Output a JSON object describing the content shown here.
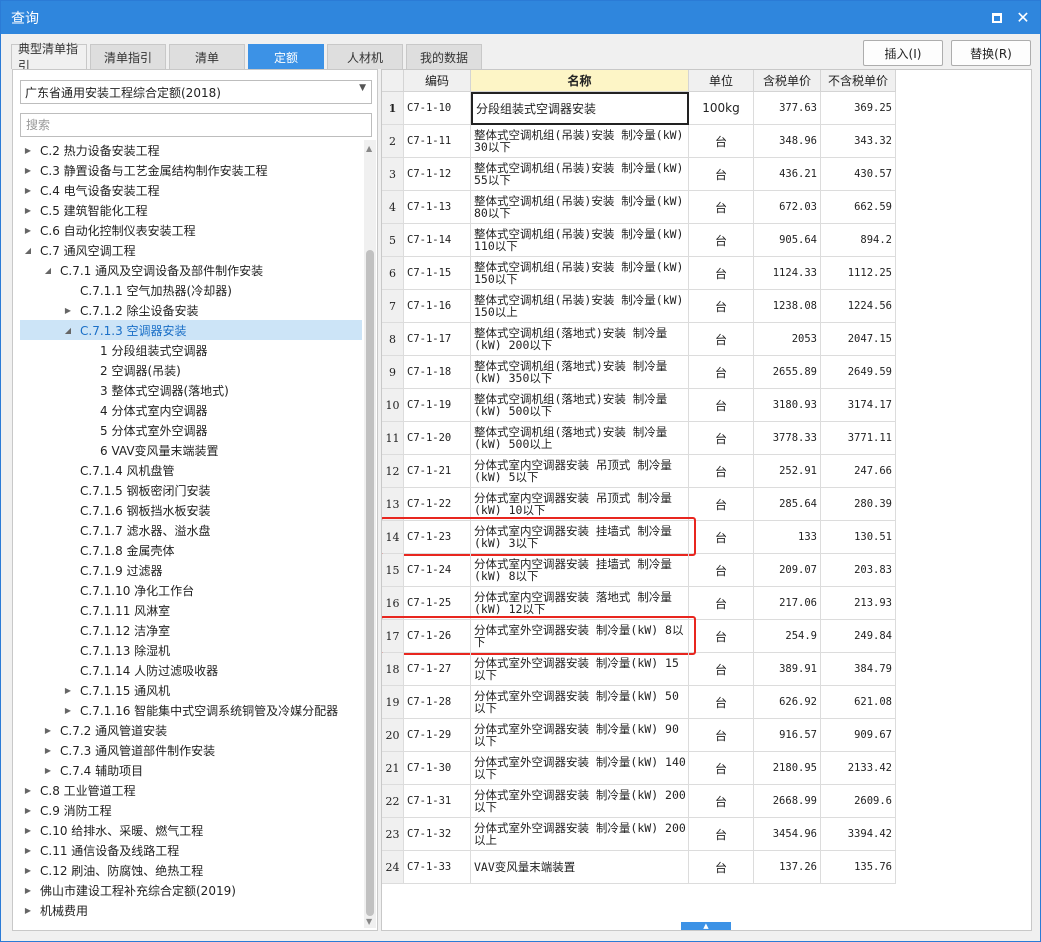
{
  "window": {
    "title": "查询",
    "maximize_icon": "maximize-icon",
    "close_icon": "close-icon"
  },
  "tabs": [
    {
      "label": "典型清单指引"
    },
    {
      "label": "清单指引"
    },
    {
      "label": "清单"
    },
    {
      "label": "定额",
      "active": true
    },
    {
      "label": "人材机"
    },
    {
      "label": "我的数据"
    }
  ],
  "buttons": {
    "insert": "插入(I)",
    "replace": "替换(R)"
  },
  "left": {
    "library": "广东省通用安装工程综合定额(2018)",
    "search_placeholder": "搜索",
    "tree": [
      {
        "level": 0,
        "toggle": "collapsed",
        "label": "C.2 热力设备安装工程"
      },
      {
        "level": 0,
        "toggle": "collapsed",
        "label": "C.3 静置设备与工艺金属结构制作安装工程"
      },
      {
        "level": 0,
        "toggle": "collapsed",
        "label": "C.4 电气设备安装工程"
      },
      {
        "level": 0,
        "toggle": "collapsed",
        "label": "C.5 建筑智能化工程"
      },
      {
        "level": 0,
        "toggle": "collapsed",
        "label": "C.6 自动化控制仪表安装工程"
      },
      {
        "level": 0,
        "toggle": "expanded",
        "label": "C.7 通风空调工程"
      },
      {
        "level": 1,
        "toggle": "expanded",
        "label": "C.7.1 通风及空调设备及部件制作安装"
      },
      {
        "level": 2,
        "toggle": "none",
        "label": "C.7.1.1 空气加热器(冷却器)"
      },
      {
        "level": 2,
        "toggle": "collapsed",
        "label": "C.7.1.2 除尘设备安装"
      },
      {
        "level": 2,
        "toggle": "expanded",
        "label": "C.7.1.3 空调器安装",
        "selected": true
      },
      {
        "level": 3,
        "toggle": "none",
        "label": "1 分段组装式空调器"
      },
      {
        "level": 3,
        "toggle": "none",
        "label": "2 空调器(吊装)"
      },
      {
        "level": 3,
        "toggle": "none",
        "label": "3 整体式空调器(落地式)"
      },
      {
        "level": 3,
        "toggle": "none",
        "label": "4 分体式室内空调器"
      },
      {
        "level": 3,
        "toggle": "none",
        "label": "5 分体式室外空调器"
      },
      {
        "level": 3,
        "toggle": "none",
        "label": "6 VAV变风量末端装置"
      },
      {
        "level": 2,
        "toggle": "none",
        "label": "C.7.1.4 风机盘管"
      },
      {
        "level": 2,
        "toggle": "none",
        "label": "C.7.1.5 钢板密闭门安装"
      },
      {
        "level": 2,
        "toggle": "none",
        "label": "C.7.1.6 钢板挡水板安装"
      },
      {
        "level": 2,
        "toggle": "none",
        "label": "C.7.1.7 滤水器、溢水盘"
      },
      {
        "level": 2,
        "toggle": "none",
        "label": "C.7.1.8 金属壳体"
      },
      {
        "level": 2,
        "toggle": "none",
        "label": "C.7.1.9 过滤器"
      },
      {
        "level": 2,
        "toggle": "none",
        "label": "C.7.1.10 净化工作台"
      },
      {
        "level": 2,
        "toggle": "none",
        "label": "C.7.1.11 风淋室"
      },
      {
        "level": 2,
        "toggle": "none",
        "label": "C.7.1.12 洁净室"
      },
      {
        "level": 2,
        "toggle": "none",
        "label": "C.7.1.13 除湿机"
      },
      {
        "level": 2,
        "toggle": "none",
        "label": "C.7.1.14 人防过滤吸收器"
      },
      {
        "level": 2,
        "toggle": "collapsed",
        "label": "C.7.1.15 通风机"
      },
      {
        "level": 2,
        "toggle": "collapsed",
        "label": "C.7.1.16 智能集中式空调系统铜管及冷媒分配器"
      },
      {
        "level": 1,
        "toggle": "collapsed",
        "label": "C.7.2 通风管道安装"
      },
      {
        "level": 1,
        "toggle": "collapsed",
        "label": "C.7.3 通风管道部件制作安装"
      },
      {
        "level": 1,
        "toggle": "collapsed",
        "label": "C.7.4 辅助项目"
      },
      {
        "level": 0,
        "toggle": "collapsed",
        "label": "C.8 工业管道工程"
      },
      {
        "level": 0,
        "toggle": "collapsed",
        "label": "C.9 消防工程"
      },
      {
        "level": 0,
        "toggle": "collapsed",
        "label": "C.10 给排水、采暖、燃气工程"
      },
      {
        "level": 0,
        "toggle": "collapsed",
        "label": "C.11 通信设备及线路工程"
      },
      {
        "level": 0,
        "toggle": "collapsed",
        "label": "C.12 刷油、防腐蚀、绝热工程"
      },
      {
        "level": 0,
        "toggle": "collapsed",
        "label": "佛山市建设工程补充综合定额(2019)"
      },
      {
        "level": 0,
        "toggle": "collapsed",
        "label": "机械费用"
      }
    ]
  },
  "table": {
    "headers": [
      "",
      "编码",
      "名称",
      "单位",
      "含税单价",
      "不含税单价"
    ],
    "rows": [
      {
        "idx": "1",
        "code": "C7-1-10",
        "name": "分段组装式空调器安装",
        "unit": "100kg",
        "tax": "377.63",
        "notax": "369.25"
      },
      {
        "idx": "2",
        "code": "C7-1-11",
        "name": "整体式空调机组(吊装)安装 制冷量(kW) 30以下",
        "unit": "台",
        "tax": "348.96",
        "notax": "343.32"
      },
      {
        "idx": "3",
        "code": "C7-1-12",
        "name": "整体式空调机组(吊装)安装 制冷量(kW) 55以下",
        "unit": "台",
        "tax": "436.21",
        "notax": "430.57"
      },
      {
        "idx": "4",
        "code": "C7-1-13",
        "name": "整体式空调机组(吊装)安装 制冷量(kW) 80以下",
        "unit": "台",
        "tax": "672.03",
        "notax": "662.59"
      },
      {
        "idx": "5",
        "code": "C7-1-14",
        "name": "整体式空调机组(吊装)安装 制冷量(kW) 110以下",
        "unit": "台",
        "tax": "905.64",
        "notax": "894.2"
      },
      {
        "idx": "6",
        "code": "C7-1-15",
        "name": "整体式空调机组(吊装)安装 制冷量(kW) 150以下",
        "unit": "台",
        "tax": "1124.33",
        "notax": "1112.25"
      },
      {
        "idx": "7",
        "code": "C7-1-16",
        "name": "整体式空调机组(吊装)安装 制冷量(kW) 150以上",
        "unit": "台",
        "tax": "1238.08",
        "notax": "1224.56"
      },
      {
        "idx": "8",
        "code": "C7-1-17",
        "name": "整体式空调机组(落地式)安装 制冷量 (kW) 200以下",
        "unit": "台",
        "tax": "2053",
        "notax": "2047.15"
      },
      {
        "idx": "9",
        "code": "C7-1-18",
        "name": "整体式空调机组(落地式)安装 制冷量 (kW) 350以下",
        "unit": "台",
        "tax": "2655.89",
        "notax": "2649.59"
      },
      {
        "idx": "10",
        "code": "C7-1-19",
        "name": "整体式空调机组(落地式)安装 制冷量 (kW) 500以下",
        "unit": "台",
        "tax": "3180.93",
        "notax": "3174.17"
      },
      {
        "idx": "11",
        "code": "C7-1-20",
        "name": "整体式空调机组(落地式)安装 制冷量 (kW) 500以上",
        "unit": "台",
        "tax": "3778.33",
        "notax": "3771.11"
      },
      {
        "idx": "12",
        "code": "C7-1-21",
        "name": "分体式室内空调器安装 吊顶式 制冷量 (kW) 5以下",
        "unit": "台",
        "tax": "252.91",
        "notax": "247.66"
      },
      {
        "idx": "13",
        "code": "C7-1-22",
        "name": "分体式室内空调器安装 吊顶式 制冷量 (kW) 10以下",
        "unit": "台",
        "tax": "285.64",
        "notax": "280.39"
      },
      {
        "idx": "14",
        "code": "C7-1-23",
        "name": "分体式室内空调器安装 挂墙式 制冷量 (kW) 3以下",
        "unit": "台",
        "tax": "133",
        "notax": "130.51",
        "highlight": true
      },
      {
        "idx": "15",
        "code": "C7-1-24",
        "name": "分体式室内空调器安装 挂墙式 制冷量 (kW) 8以下",
        "unit": "台",
        "tax": "209.07",
        "notax": "203.83"
      },
      {
        "idx": "16",
        "code": "C7-1-25",
        "name": "分体式室内空调器安装 落地式 制冷量 (kW) 12以下",
        "unit": "台",
        "tax": "217.06",
        "notax": "213.93"
      },
      {
        "idx": "17",
        "code": "C7-1-26",
        "name": "分体式室外空调器安装 制冷量(kW) 8以下",
        "unit": "台",
        "tax": "254.9",
        "notax": "249.84",
        "highlight": true
      },
      {
        "idx": "18",
        "code": "C7-1-27",
        "name": "分体式室外空调器安装 制冷量(kW) 15以下",
        "unit": "台",
        "tax": "389.91",
        "notax": "384.79"
      },
      {
        "idx": "19",
        "code": "C7-1-28",
        "name": "分体式室外空调器安装 制冷量(kW) 50以下",
        "unit": "台",
        "tax": "626.92",
        "notax": "621.08"
      },
      {
        "idx": "20",
        "code": "C7-1-29",
        "name": "分体式室外空调器安装 制冷量(kW) 90以下",
        "unit": "台",
        "tax": "916.57",
        "notax": "909.67"
      },
      {
        "idx": "21",
        "code": "C7-1-30",
        "name": "分体式室外空调器安装 制冷量(kW) 140以下",
        "unit": "台",
        "tax": "2180.95",
        "notax": "2133.42"
      },
      {
        "idx": "22",
        "code": "C7-1-31",
        "name": "分体式室外空调器安装 制冷量(kW) 200以下",
        "unit": "台",
        "tax": "2668.99",
        "notax": "2609.6"
      },
      {
        "idx": "23",
        "code": "C7-1-32",
        "name": "分体式室外空调器安装 制冷量(kW) 200以上",
        "unit": "台",
        "tax": "3454.96",
        "notax": "3394.42"
      },
      {
        "idx": "24",
        "code": "C7-1-33",
        "name": "VAV变风量末端装置",
        "unit": "台",
        "tax": "137.26",
        "notax": "135.76"
      }
    ]
  },
  "colors": {
    "titlebar": "#2f86dd",
    "active_tab": "#3c92e6",
    "highlight_box": "#e8261f",
    "name_header": "#fdf5c6",
    "tree_selected": "#cce4f7"
  }
}
